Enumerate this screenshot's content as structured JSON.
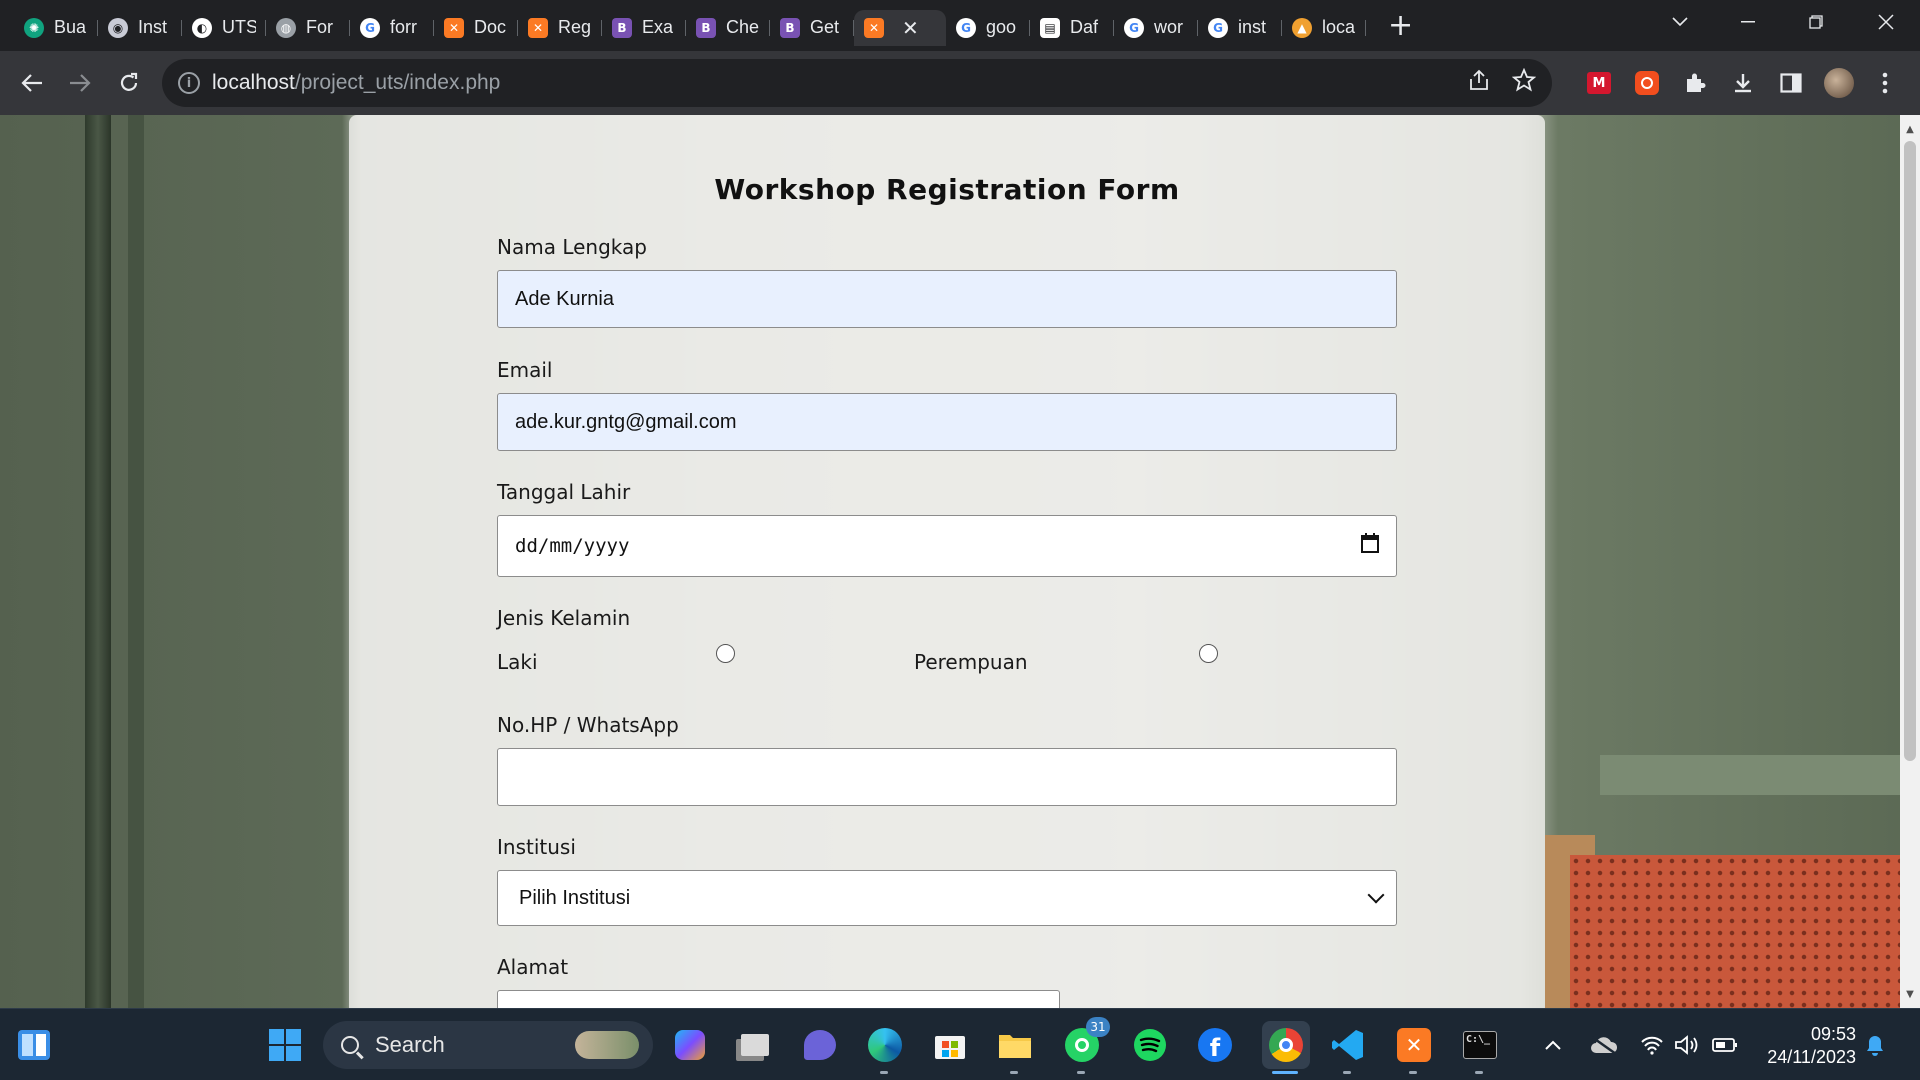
{
  "browser": {
    "tabs": [
      {
        "label": "Bua",
        "icon": "chatgpt-icon",
        "color": "#10a37f"
      },
      {
        "label": "Inst",
        "icon": "university-logo-icon",
        "color": "#c9cbd6"
      },
      {
        "label": "UTS",
        "icon": "github-icon",
        "color": "#ffffff"
      },
      {
        "label": "For",
        "icon": "globe-icon",
        "color": "#9aa0a6"
      },
      {
        "label": "forr",
        "icon": "google-icon",
        "color": "#ffffff"
      },
      {
        "label": "Doc",
        "icon": "xampp-icon",
        "color": "#fb7a24"
      },
      {
        "label": "Reg",
        "icon": "xampp-icon",
        "color": "#fb7a24"
      },
      {
        "label": "Exa",
        "icon": "bootstrap-icon",
        "color": "#7952b3"
      },
      {
        "label": "Che",
        "icon": "bootstrap-icon",
        "color": "#7952b3"
      },
      {
        "label": "Get",
        "icon": "bootstrap-icon",
        "color": "#7952b3"
      },
      {
        "label": "",
        "icon": "xampp-icon",
        "color": "#fb7a24",
        "active": true
      },
      {
        "label": "goo",
        "icon": "google-icon",
        "color": "#ffffff"
      },
      {
        "label": "Daf",
        "icon": "news-icon",
        "color": "#ffffff"
      },
      {
        "label": "wor",
        "icon": "google-icon",
        "color": "#ffffff"
      },
      {
        "label": "inst",
        "icon": "google-icon",
        "color": "#ffffff"
      },
      {
        "label": "loca",
        "icon": "xampp-tent-icon",
        "color": "#f0a030"
      }
    ],
    "url_host": "localhost",
    "url_path": "/project_uts/index.php"
  },
  "form": {
    "title": "Workshop Registration Form",
    "name_label": "Nama Lengkap",
    "name_value": "Ade Kurnia",
    "email_label": "Email",
    "email_value": "ade.kur.gntg@gmail.com",
    "dob_label": "Tanggal Lahir",
    "dob_placeholder": "dd/mm/yyyy",
    "gender_label": "Jenis Kelamin",
    "gender_male": "Laki",
    "gender_female": "Perempuan",
    "phone_label": "No.HP / WhatsApp",
    "phone_value": "",
    "institution_label": "Institusi",
    "institution_selected": "Pilih Institusi",
    "address_label": "Alamat"
  },
  "taskbar": {
    "search_placeholder": "Search",
    "whatsapp_badge": "31",
    "time": "09:53",
    "date": "24/11/2023"
  },
  "colors": {
    "autofill_bg": "#e8f0fe",
    "chrome_dark": "#202124",
    "taskbar_bg": "#1c2733"
  }
}
